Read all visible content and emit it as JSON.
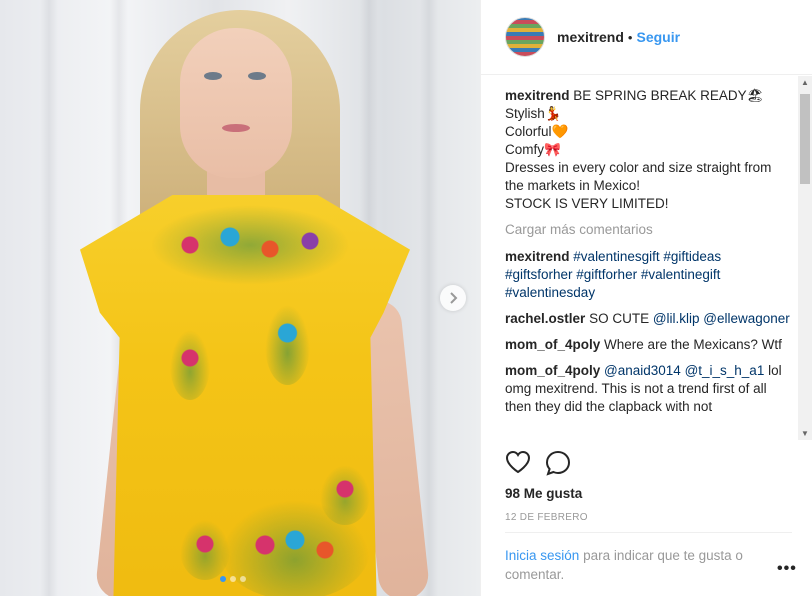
{
  "header": {
    "username": "mexitrend",
    "separator": "•",
    "follow_label": "Seguir"
  },
  "caption": {
    "username": "mexitrend",
    "lines": [
      "BE SPRING BREAK READY🏖",
      "Stylish💃",
      "Colorful🧡",
      "Comfy🎀",
      "Dresses in every color and size straight from the markets in Mexico!",
      "STOCK IS VERY LIMITED!"
    ]
  },
  "load_more_label": "Cargar más comentarios",
  "comments": [
    {
      "username": "mexitrend",
      "text": "#valentinesgift #giftideas #giftsforher #giftforher #valentinegift #valentinesday"
    },
    {
      "username": "rachel.ostler",
      "text_before": "SO CUTE ",
      "mentions": "@lil.klip @ellewagoner"
    },
    {
      "username": "mom_of_4poly",
      "text": "Where are the Mexicans? Wtf"
    },
    {
      "username": "mom_of_4poly",
      "mentions": "@anaid3014 @t_i_s_h_a1",
      "text_after": "lol omg mexitrend. This is not a trend first of all then they did the clapback with not"
    }
  ],
  "likes_label": "98 Me gusta",
  "date_label": "12 DE FEBRERO",
  "login": {
    "link_label": "Inicia sesión",
    "rest": "para indicar que te gusta o comentar."
  },
  "options_label": "•••",
  "icons": {
    "like": "heart-icon",
    "comment": "comment-icon",
    "next": "chevron-right-icon",
    "more": "more-options-icon"
  },
  "carousel": {
    "count": 3,
    "active_index": 0
  },
  "colors": {
    "accent": "#3897f0",
    "hashtag": "#003569",
    "muted": "#999999"
  }
}
